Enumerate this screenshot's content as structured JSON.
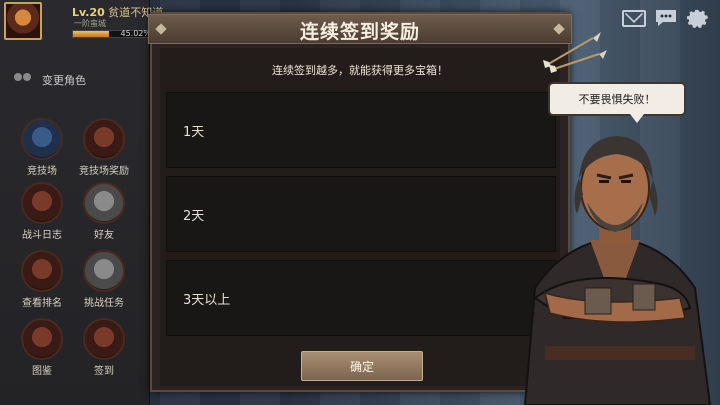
{
  "player": {
    "level": "Lv.20",
    "name": "贫道不知道",
    "subtitle": "一阶蛮城",
    "exp_percent_text": "45.02%",
    "exp_fraction": 0.4502
  },
  "sidebar": {
    "change_role": "变更角色",
    "items": [
      {
        "label": "竞技场",
        "icon": "arena-flag-icon"
      },
      {
        "label": "竞技场奖励",
        "icon": "arena-reward-icon"
      },
      {
        "label": "战斗日志",
        "icon": "battle-log-icon"
      },
      {
        "label": "好友",
        "icon": "friends-icon"
      },
      {
        "label": "查看排名",
        "icon": "ranking-icon"
      },
      {
        "label": "挑战任务",
        "icon": "challenge-scroll-icon"
      },
      {
        "label": "图鉴",
        "icon": "codex-book-icon"
      },
      {
        "label": "签到",
        "icon": "checkin-icon"
      }
    ]
  },
  "top_icons": [
    "mail-icon",
    "chat-icon",
    "gear-icon"
  ],
  "dialog": {
    "title": "连续签到奖励",
    "description": "连续签到越多，就能获得更多宝箱！",
    "rows": [
      {
        "label": "1天"
      },
      {
        "label": "2天"
      },
      {
        "label": "3天以上"
      }
    ],
    "confirm_label": "确定"
  },
  "speech": {
    "text": "不要畏惧失败！"
  },
  "colors": {
    "dialog_bg": "#2b2321",
    "title_bar": "#5c4b3e",
    "confirm_button": "#94795f",
    "row_bg": "#191716"
  }
}
